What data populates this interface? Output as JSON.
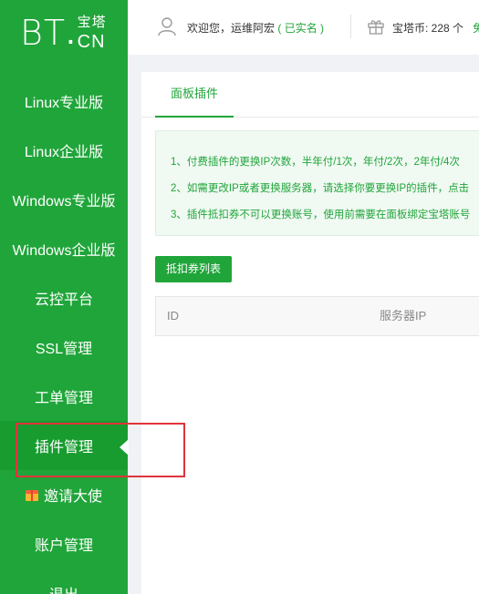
{
  "logo": {
    "bt": "BT",
    "dot": ".",
    "cn_chars": "宝塔",
    "cn": "CN"
  },
  "sidebar": {
    "items": [
      {
        "label": "Linux专业版"
      },
      {
        "label": "Linux企业版"
      },
      {
        "label": "Windows专业版"
      },
      {
        "label": "Windows企业版"
      },
      {
        "label": "云控平台"
      },
      {
        "label": "SSL管理"
      },
      {
        "label": "工单管理"
      },
      {
        "label": "插件管理",
        "active": true
      },
      {
        "label": "邀请大使",
        "icon": "gift-icon"
      },
      {
        "label": "账户管理"
      },
      {
        "label": "退出"
      }
    ]
  },
  "header": {
    "welcome": "欢迎您，运维阿宏",
    "verified": "( 已实名 )",
    "coins": "宝塔币: 228 个",
    "extra": "免"
  },
  "main": {
    "tab": "面板插件",
    "notices": [
      "1、付费插件的更换IP次数，半年付/1次，年付/2次，2年付/4次",
      "2、如需更改IP或者更换服务器，请选择你要更换IP的插件，点击",
      "3、插件抵扣券不可以更换账号，使用前需要在面板绑定宝塔账号"
    ],
    "coupon_button": "抵扣券列表",
    "table": {
      "columns": [
        "ID",
        "服务器IP"
      ]
    }
  },
  "colors": {
    "brand": "#20a53a",
    "highlight": "#e0333c"
  }
}
